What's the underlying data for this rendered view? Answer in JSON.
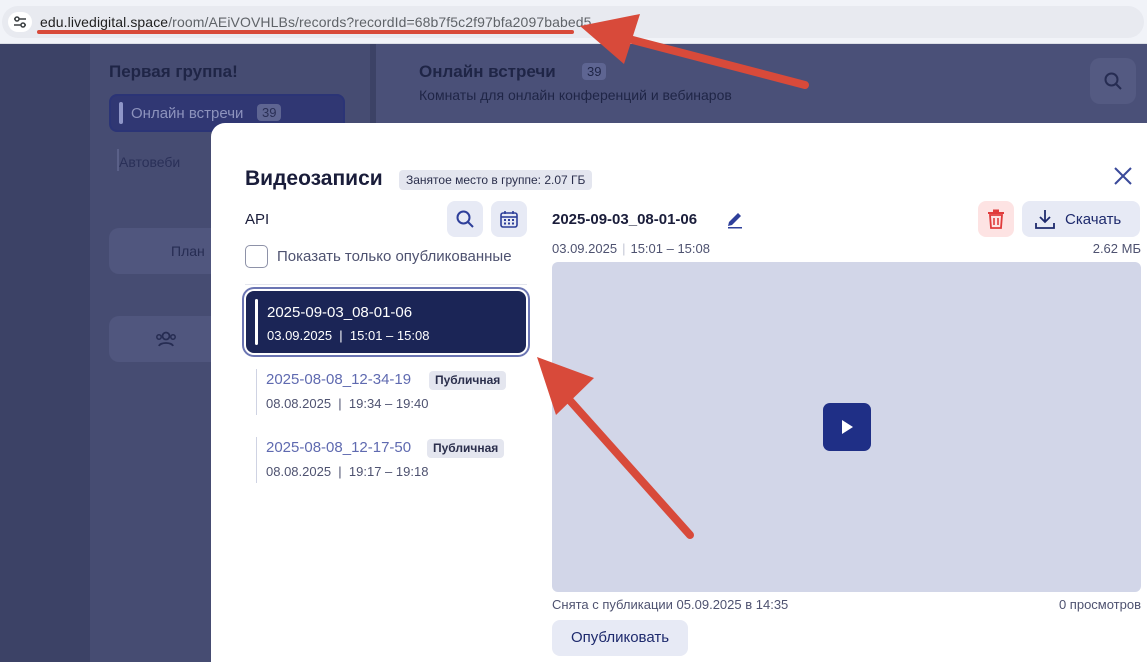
{
  "browser": {
    "url_host": "edu.livedigital.space",
    "url_path": "/room/AEiVOVHLBs/records?recordId=68b7f5c2f97bfa2097babed5"
  },
  "background": {
    "group_title": "Первая группа!",
    "nav_active_label": "Онлайн встречи",
    "nav_active_count": "39",
    "nav_second_label": "Автовеби",
    "plan_button_label": "План",
    "main_title": "Онлайн встречи",
    "main_count": "39",
    "main_subtitle": "Комнаты для онлайн конференций и вебинаров"
  },
  "modal": {
    "title": "Видеозаписи",
    "storage_badge": "Занятое место в группе: 2.07 ГБ",
    "list_title": "API",
    "checkbox_label": "Показать только опубликованные",
    "records": [
      {
        "name": "2025-09-03_08-01-06",
        "date": "03.09.2025",
        "time": "15:01 – 15:08",
        "badge": ""
      },
      {
        "name": "2025-08-08_12-34-19",
        "date": "08.08.2025",
        "time": "19:34 – 19:40",
        "badge": "Публичная"
      },
      {
        "name": "2025-08-08_12-17-50",
        "date": "08.08.2025",
        "time": "19:17 – 19:18",
        "badge": "Публичная"
      }
    ],
    "detail": {
      "name": "2025-09-03_08-01-06",
      "date": "03.09.2025",
      "time": "15:01 – 15:08",
      "size": "2.62 МБ",
      "download_label": "Скачать",
      "unpublished_text": "Снята с публикации 05.09.2025 в 14:35",
      "views": "0 просмотров",
      "publish_label": "Опубликовать"
    }
  },
  "colors": {
    "accent": "#1b2556",
    "annotation": "#d84a3a",
    "play_button": "#1f2f86"
  },
  "icons": [
    "tune-icon",
    "search-icon",
    "calendar-icon",
    "close-icon",
    "edit-icon",
    "trash-icon",
    "download-icon",
    "play-icon",
    "users-icon"
  ]
}
